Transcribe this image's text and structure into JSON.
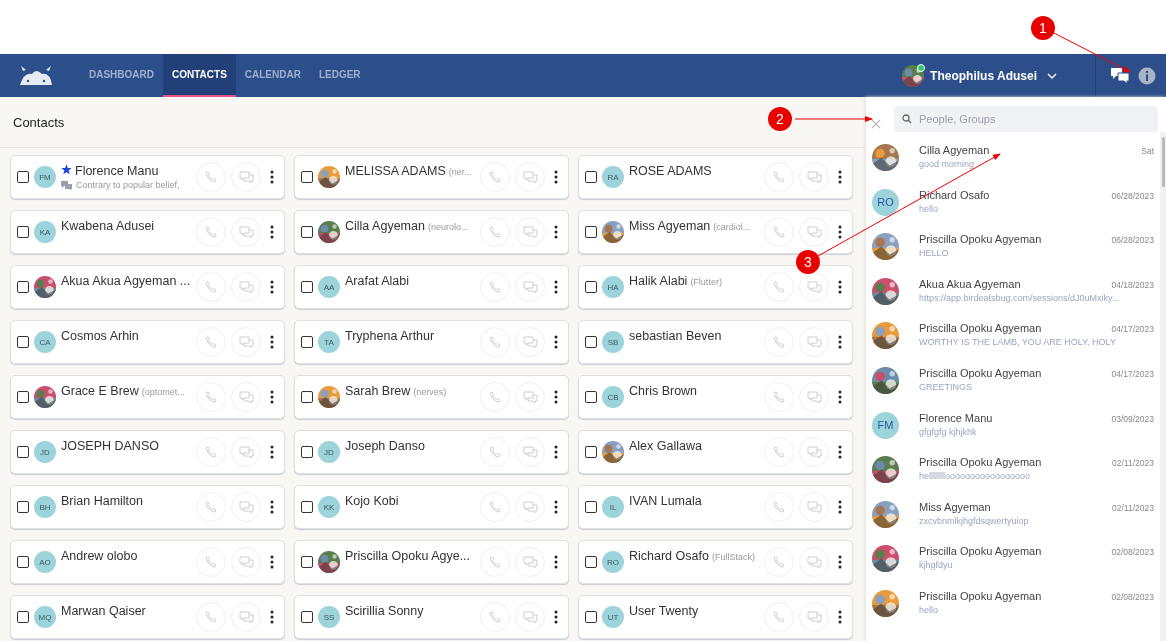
{
  "navbar": {
    "tabs": [
      {
        "label": "DASHBOARD",
        "selected": false
      },
      {
        "label": "CONTACTS",
        "selected": true
      },
      {
        "label": "CALENDAR",
        "selected": false
      },
      {
        "label": "LEDGER",
        "selected": false
      }
    ],
    "user": {
      "name": "Theophilus Adusei",
      "online": true
    }
  },
  "contacts": {
    "title": "Contacts",
    "items": [
      {
        "name": "Florence Manu",
        "initials": "FM",
        "starred": true,
        "last_message": "Contrary to popular belief,",
        "checked": false
      },
      {
        "name": "MELISSA ADAMS",
        "tag": "(ner...",
        "checked": false
      },
      {
        "name": "ROSE ADAMS",
        "initials": "RA",
        "checked": false
      },
      {
        "name": "Kwabena Adusei",
        "initials": "KA",
        "checked": false
      },
      {
        "name": "Cilla Agyeman",
        "tag": "(neurolo...",
        "checked": false
      },
      {
        "name": "Miss Agyeman",
        "tag": "(cardiol...",
        "checked": false
      },
      {
        "name": "Akua Akua Agyeman ...",
        "checked": false
      },
      {
        "name": "Arafat Alabi",
        "initials": "AA",
        "checked": false
      },
      {
        "name": "Halik Alabi",
        "tag": "(Flutter)",
        "initials": "HA",
        "checked": false
      },
      {
        "name": "Cosmos Arhin",
        "initials": "CA",
        "checked": false
      },
      {
        "name": "Tryphena Arthur",
        "initials": "TA",
        "checked": false
      },
      {
        "name": "sebastian Beven",
        "initials": "SB",
        "checked": false
      },
      {
        "name": "Grace E Brew",
        "tag": "(optomet...",
        "checked": false
      },
      {
        "name": "Sarah Brew",
        "tag": "(nerves)",
        "checked": false
      },
      {
        "name": "Chris Brown",
        "initials": "CB",
        "checked": false
      },
      {
        "name": "JOSEPH DANSO",
        "initials": "JD",
        "checked": false
      },
      {
        "name": "Joseph Danso",
        "initials": "JD",
        "checked": false
      },
      {
        "name": "Alex Gallawa",
        "checked": false
      },
      {
        "name": "Brian Hamilton",
        "initials": "BH",
        "checked": false
      },
      {
        "name": "Kojo Kobi",
        "initials": "KK",
        "checked": false
      },
      {
        "name": "IVAN Lumala",
        "initials": "IL",
        "checked": false
      },
      {
        "name": "Andrew olobo",
        "initials": "AO",
        "checked": false
      },
      {
        "name": "Priscilla Opoku Agye...",
        "checked": false
      },
      {
        "name": "Richard Osafo",
        "tag": "(FullStack)",
        "initials": "RO",
        "checked": false
      },
      {
        "name": "Marwan Qaiser",
        "initials": "MQ",
        "checked": false
      },
      {
        "name": "Scirillia Sonny",
        "initials": "SS",
        "checked": false
      },
      {
        "name": "User Twenty",
        "initials": "UT",
        "checked": false
      }
    ]
  },
  "chat_panel": {
    "search": {
      "placeholder": "People, Groups"
    },
    "conversations": [
      {
        "name": "Cilla Agyeman",
        "message": "good morning",
        "date": "Sat"
      },
      {
        "name": "Richard Osafo",
        "message": "hello",
        "date": "06/28/2023",
        "initials": "RO"
      },
      {
        "name": "Priscilla Opoku Agyeman",
        "message": "HELLO",
        "date": "06/28/2023"
      },
      {
        "name": "Akua Akua Agyeman",
        "message": "https://app.birdeatsbug.com/sessions/dJ0uMxiky...",
        "date": "04/18/2023"
      },
      {
        "name": "Priscilla Opoku Agyeman",
        "message": "WORTHY IS THE LAMB, YOU ARE HOLY, HOLY",
        "date": "04/17/2023"
      },
      {
        "name": "Priscilla Opoku Agyeman",
        "message": "GREETINGS",
        "date": "04/17/2023"
      },
      {
        "name": "Florence Manu",
        "message": "gfgfgfg kjhjkhk",
        "date": "03/09/2023",
        "initials": "FM"
      },
      {
        "name": "Priscilla Opoku Agyeman",
        "message": "hellllllllooooooooooooooooo",
        "date": "02/11/2023"
      },
      {
        "name": "Miss Agyeman",
        "message": "zxcvbnmlkjhgfdsqwertyuiop",
        "date": "02/11/2023"
      },
      {
        "name": "Priscilla Opoku Agyeman",
        "message": "kjhgfdyu",
        "date": "02/08/2023"
      },
      {
        "name": "Priscilla Opoku Agyeman",
        "message": "hello",
        "date": "02/08/2023"
      }
    ]
  },
  "annotations": [
    "1",
    "2",
    "3"
  ]
}
